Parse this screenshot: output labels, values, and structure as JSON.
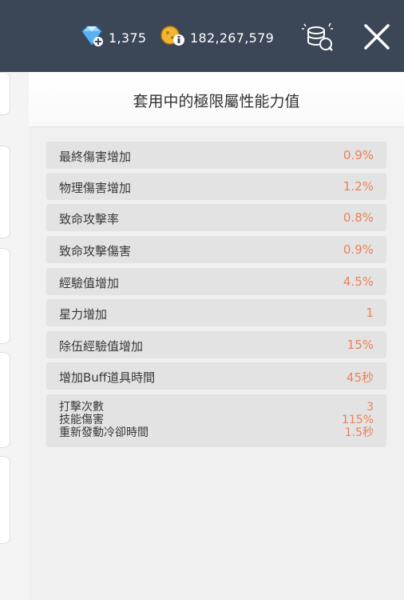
{
  "header": {
    "gem_amount": "1,375",
    "meso_amount": "182,267,579"
  },
  "panel": {
    "title": "套用中的極限屬性能力值",
    "stats": [
      {
        "label": "最終傷害增加",
        "value": "0.9%"
      },
      {
        "label": "物理傷害增加",
        "value": "1.2%"
      },
      {
        "label": "致命攻擊率",
        "value": "0.8%"
      },
      {
        "label": "致命攻擊傷害",
        "value": "0.9%"
      },
      {
        "label": "經驗值增加",
        "value": "4.5%"
      },
      {
        "label": "星力增加",
        "value": "1"
      },
      {
        "label": "除伍經驗值增加",
        "value": "15%"
      },
      {
        "label": "增加Buff道具時間",
        "value": "45秒"
      }
    ],
    "multi_stat": [
      {
        "label": "打擊次數",
        "value": "3"
      },
      {
        "label": "技能傷害",
        "value": "115%"
      },
      {
        "label": "重新發動冷卻時間",
        "value": "1.5秒"
      }
    ]
  },
  "colors": {
    "header_bg": "#3b4657",
    "value_accent": "#e8815a",
    "row_bg": "#e3e3e3"
  },
  "icons": {
    "gem": "gem-icon",
    "mesos": "mesos-icon",
    "shop": "coin-shop-icon",
    "close": "close-icon"
  }
}
